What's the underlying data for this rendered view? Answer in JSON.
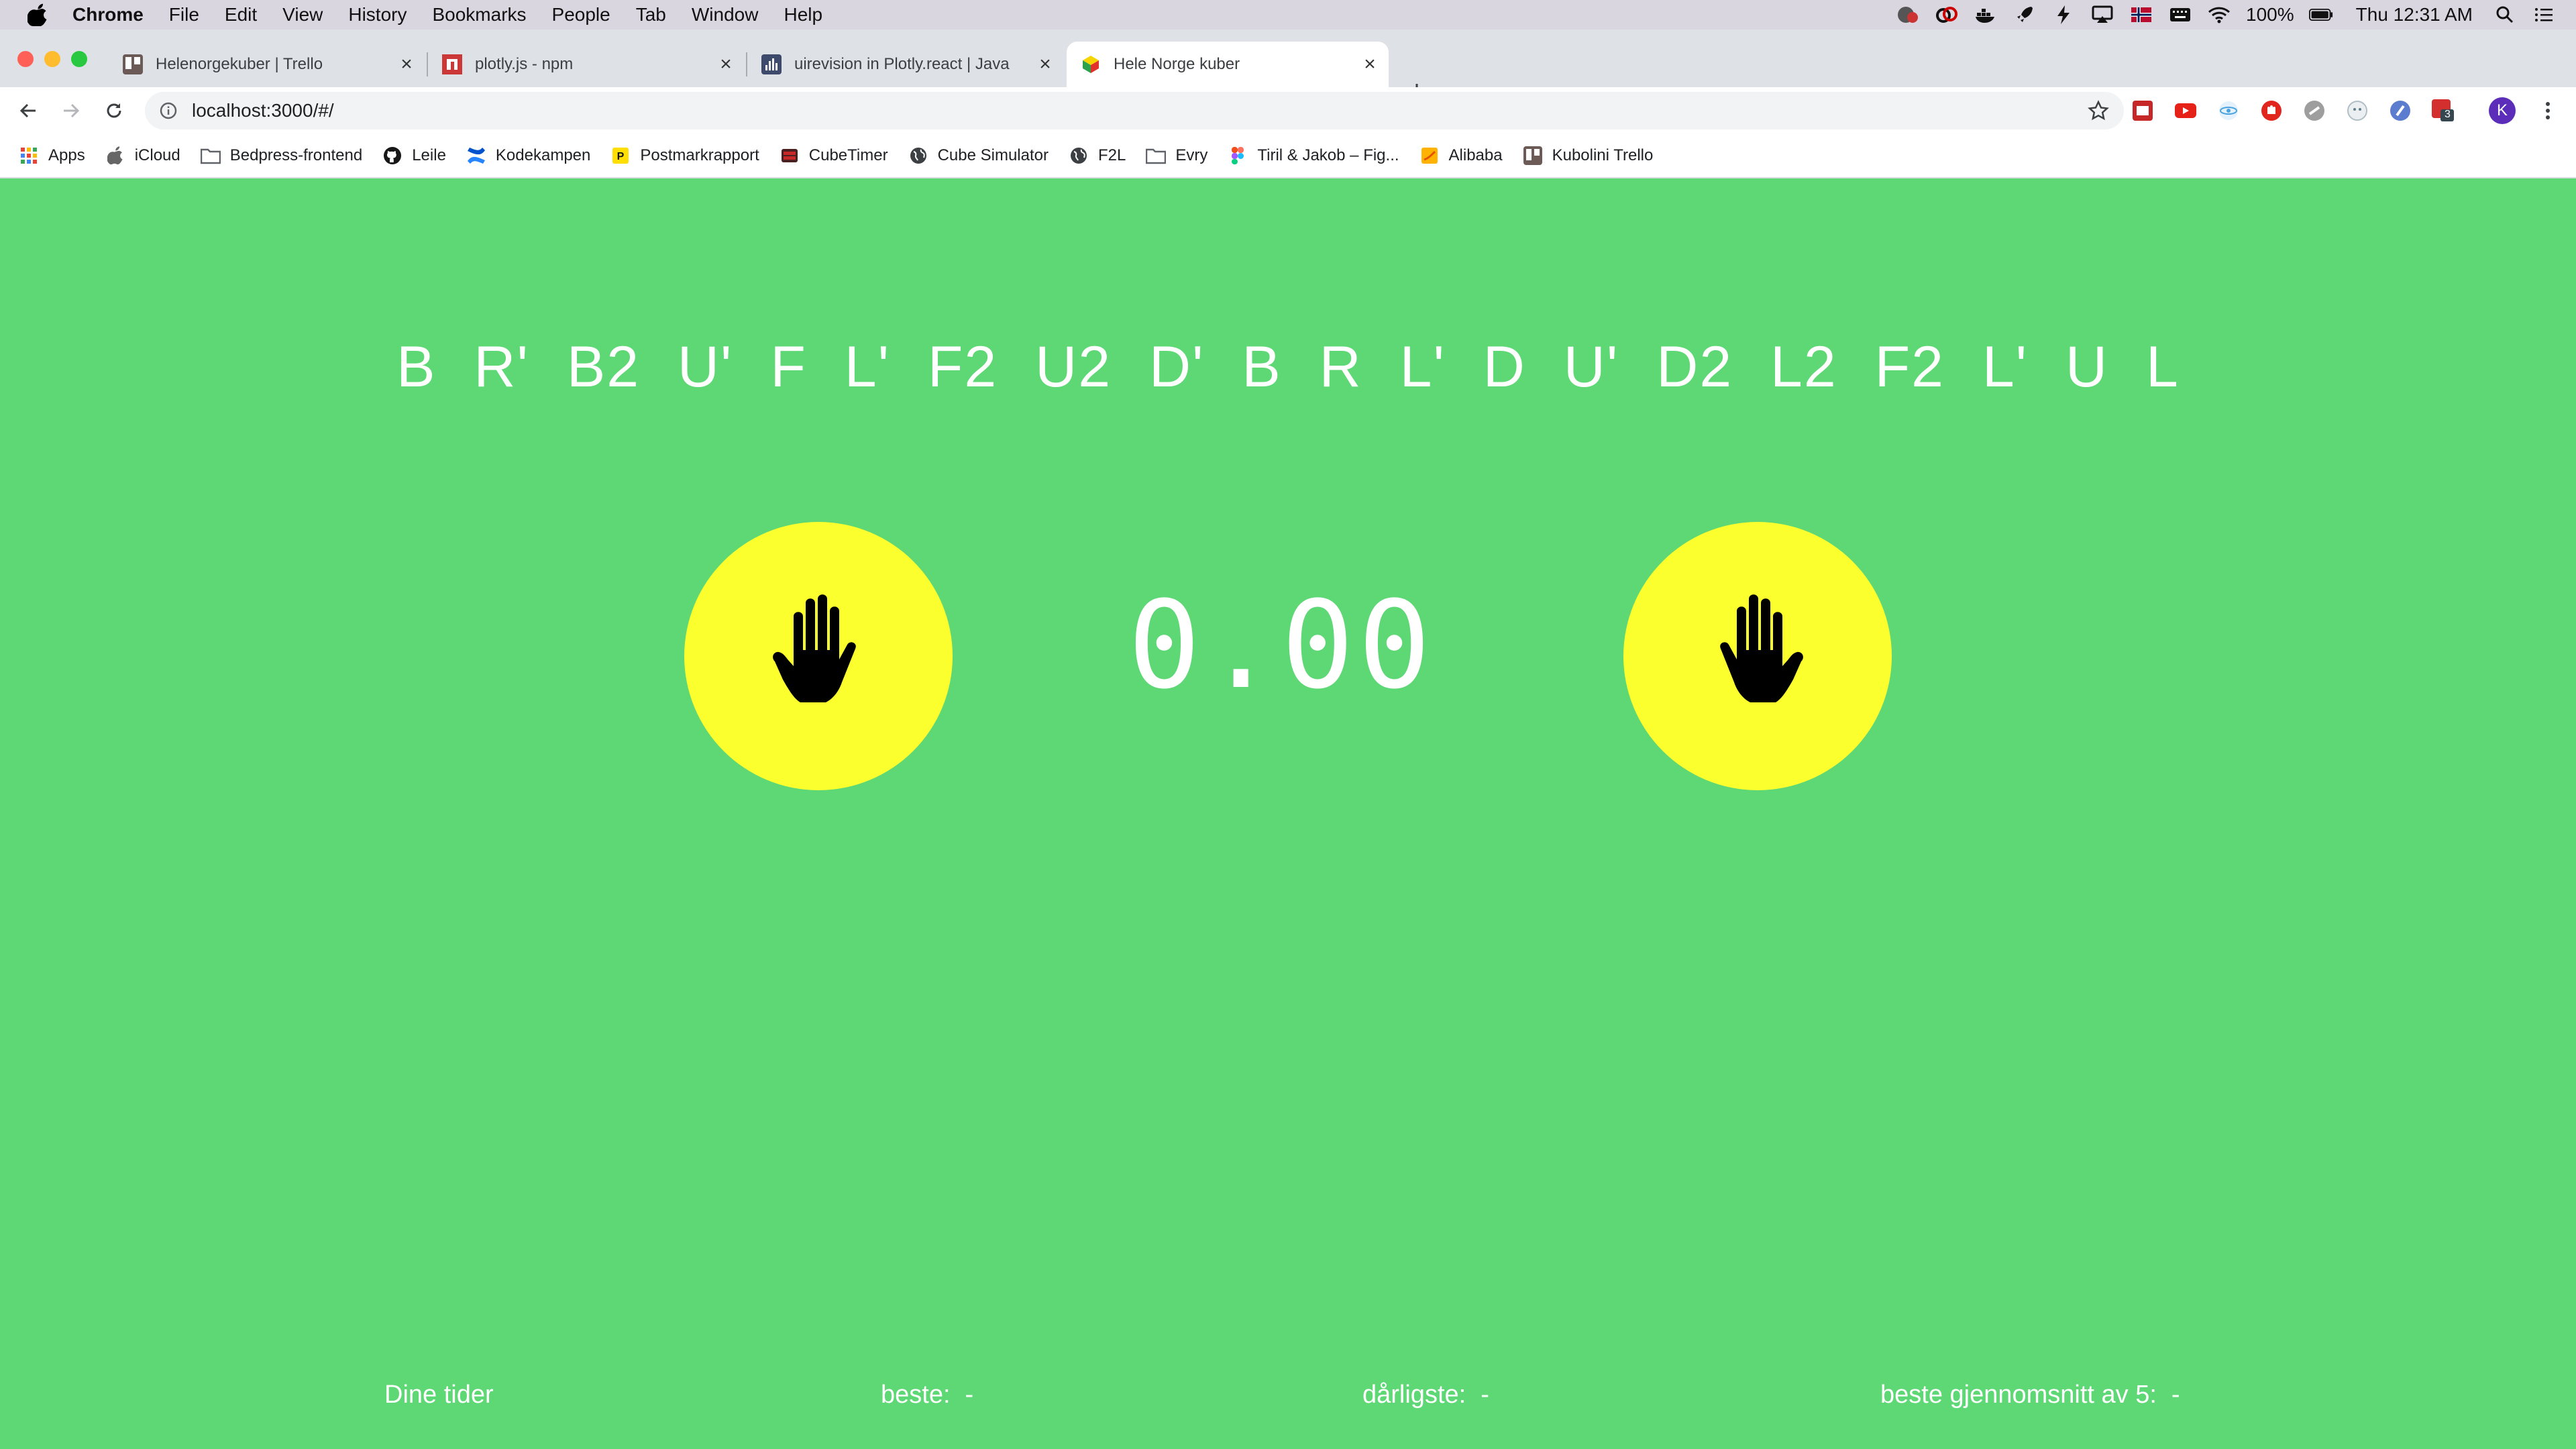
{
  "menubar": {
    "app": "Chrome",
    "items": [
      "File",
      "Edit",
      "View",
      "History",
      "Bookmarks",
      "People",
      "Tab",
      "Window",
      "Help"
    ],
    "battery": "100%",
    "clock": "Thu 12:31 AM"
  },
  "tabs": [
    {
      "title": "Helenorgekuber | Trello",
      "icon": "trello-icon"
    },
    {
      "title": "plotly.js - npm",
      "icon": "npm-icon"
    },
    {
      "title": "uirevision in Plotly.react | Java",
      "icon": "plotly-icon"
    },
    {
      "title": "Hele Norge kuber",
      "icon": "cube-icon",
      "active": true
    }
  ],
  "toolbar": {
    "url": "localhost:3000/#/",
    "avatar_letter": "K",
    "ext_badge": "3"
  },
  "bookmarks": [
    {
      "label": "Apps",
      "icon": "apps-grid-icon"
    },
    {
      "label": "iCloud",
      "icon": "apple-icon"
    },
    {
      "label": "Bedpress-frontend",
      "icon": "folder-icon"
    },
    {
      "label": "Leile",
      "icon": "github-icon"
    },
    {
      "label": "Kodekampen",
      "icon": "confluence-icon"
    },
    {
      "label": "Postmarkrapport",
      "icon": "postmark-icon"
    },
    {
      "label": "CubeTimer",
      "icon": "cubetimer-icon"
    },
    {
      "label": "Cube Simulator",
      "icon": "globe-icon"
    },
    {
      "label": "F2L",
      "icon": "globe-icon"
    },
    {
      "label": "Evry",
      "icon": "folder-icon"
    },
    {
      "label": "Tiril & Jakob – Fig...",
      "icon": "figma-icon"
    },
    {
      "label": "Alibaba",
      "icon": "alibaba-icon"
    },
    {
      "label": "Kubolini Trello",
      "icon": "trello-icon"
    }
  ],
  "page": {
    "scramble": "B R' B2 U' F L' F2 U2 D' B R L' D U' D2 L2 F2 L' U L",
    "timer": "0.00",
    "stats": {
      "label": "Dine tider",
      "best_label": "beste:",
      "best_value": "-",
      "worst_label": "dårligste:",
      "worst_value": "-",
      "avg5_label": "beste gjennomsnitt av 5:",
      "avg5_value": "-"
    }
  },
  "colors": {
    "background": "#5dd874",
    "pad": "#fbff2e"
  }
}
